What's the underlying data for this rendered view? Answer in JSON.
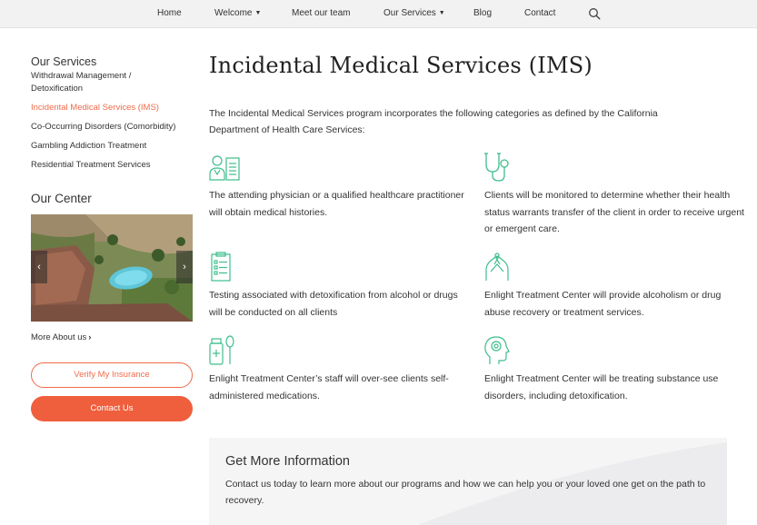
{
  "nav": {
    "items": [
      {
        "label": "Home"
      },
      {
        "label": "Welcome",
        "has_dropdown": true
      },
      {
        "label": "Meet our team"
      },
      {
        "label": "Our Services",
        "has_dropdown": true
      },
      {
        "label": "Blog"
      },
      {
        "label": "Contact"
      }
    ],
    "search_icon": "search-icon"
  },
  "sidebar": {
    "services_heading": "Our Services",
    "services": [
      {
        "label": "Withdrawal Management / Detoxification",
        "active": false
      },
      {
        "label": "Incidental Medical Services (IMS)",
        "active": true
      },
      {
        "label": "Co-Occurring Disorders (Comorbidity)",
        "active": false
      },
      {
        "label": "Gambling Addiction Treatment",
        "active": false
      },
      {
        "label": "Residential Treatment Services",
        "active": false
      }
    ],
    "center_heading": "Our Center",
    "more_about": "More About us",
    "verify_button": "Verify My Insurance",
    "contact_button": "Contact Us"
  },
  "main": {
    "title": "Incidental Medical Services (IMS)",
    "intro": "The Incidental Medical Services program incorporates the following categories as defined by the California Department of Health Care Services:",
    "features": [
      {
        "icon": "medical-history-icon",
        "text": "The attending physician or a qualified healthcare practitioner will obtain medical histories."
      },
      {
        "icon": "stethoscope-icon",
        "text": "Clients will be monitored to determine whether their health status warrants transfer of the client in order to receive urgent or emergent care."
      },
      {
        "icon": "test-report-icon",
        "text": "Testing associated with detoxification from alcohol or drugs will be conducted on all clients"
      },
      {
        "icon": "caring-hands-icon",
        "text": "Enlight Treatment Center will provide alcoholism or drug abuse recovery or treatment services."
      },
      {
        "icon": "medication-icon",
        "text": "Enlight Treatment Center’s staff will over-see clients self-administered medications."
      },
      {
        "icon": "mind-head-icon",
        "text": "Enlight Treatment Center will be treating substance use disorders, including detoxification."
      }
    ]
  },
  "info": {
    "title": "Get More Information",
    "text": "Contact us today to learn more about our programs and how we can help you or your loved one get on the path to recovery."
  },
  "colors": {
    "accent": "#ef6b4a",
    "icon_green": "#3dbd8c",
    "nav_bg": "#f2f2f2"
  }
}
